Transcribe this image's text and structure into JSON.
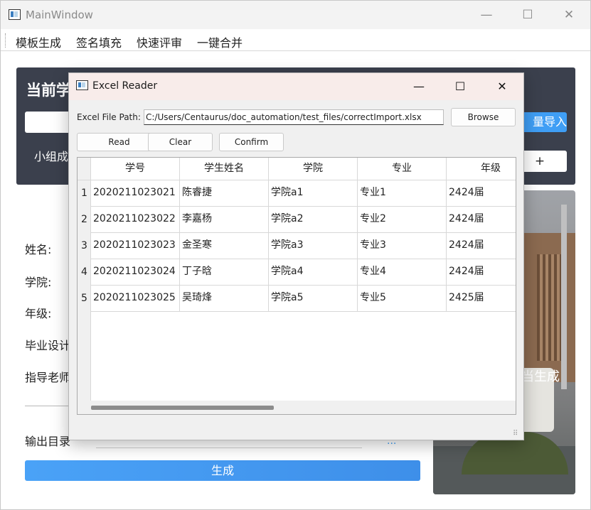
{
  "main_window": {
    "title": "MainWindow",
    "controls": {
      "minimize": "—",
      "maximize": "☐",
      "close": "✕"
    },
    "menu": [
      "模板生成",
      "签名填充",
      "快速评审",
      "一键合并"
    ],
    "top_panel": {
      "title": "当前学",
      "group_label": "小组成",
      "batch_import": "量导入",
      "add_button": "+"
    },
    "form_labels": {
      "name": "姓名:",
      "college": "学院:",
      "grade": "年级:",
      "thesis": "毕业设计",
      "advisor": "指导老师"
    },
    "output_label": "输出目录",
    "browse_dots": "...",
    "generate_button": "生成",
    "image_caption": "当生成"
  },
  "dialog": {
    "title": "Excel Reader",
    "controls": {
      "minimize": "—",
      "maximize": "☐",
      "close": "✕"
    },
    "file_path_label": "Excel File Path:",
    "file_path_value": "C:/Users/Centaurus/doc_automation/test_files/correctImport.xlsx",
    "buttons": {
      "browse": "Browse",
      "read": "Read",
      "clear": "Clear",
      "confirm": "Confirm"
    },
    "table": {
      "headers": [
        "学号",
        "学生姓名",
        "学院",
        "专业",
        "年级"
      ],
      "rows": [
        {
          "num": "1",
          "cells": [
            "2020211023021",
            "陈睿捷",
            "学院a1",
            "专业1",
            "2424届"
          ]
        },
        {
          "num": "2",
          "cells": [
            "2020211023022",
            "李嘉杨",
            "学院a2",
            "专业2",
            "2424届"
          ]
        },
        {
          "num": "3",
          "cells": [
            "2020211023023",
            "金圣寒",
            "学院a3",
            "专业3",
            "2424届"
          ]
        },
        {
          "num": "4",
          "cells": [
            "2020211023024",
            "丁子晗",
            "学院a4",
            "专业4",
            "2424届"
          ]
        },
        {
          "num": "5",
          "cells": [
            "2020211023025",
            "吴琦烽",
            "学院a5",
            "专业5",
            "2425届"
          ]
        }
      ]
    }
  },
  "colors": {
    "accent": "#3f9ef5",
    "panel_dark": "#3b404d",
    "dialog_title_bg": "#f8ecea"
  }
}
